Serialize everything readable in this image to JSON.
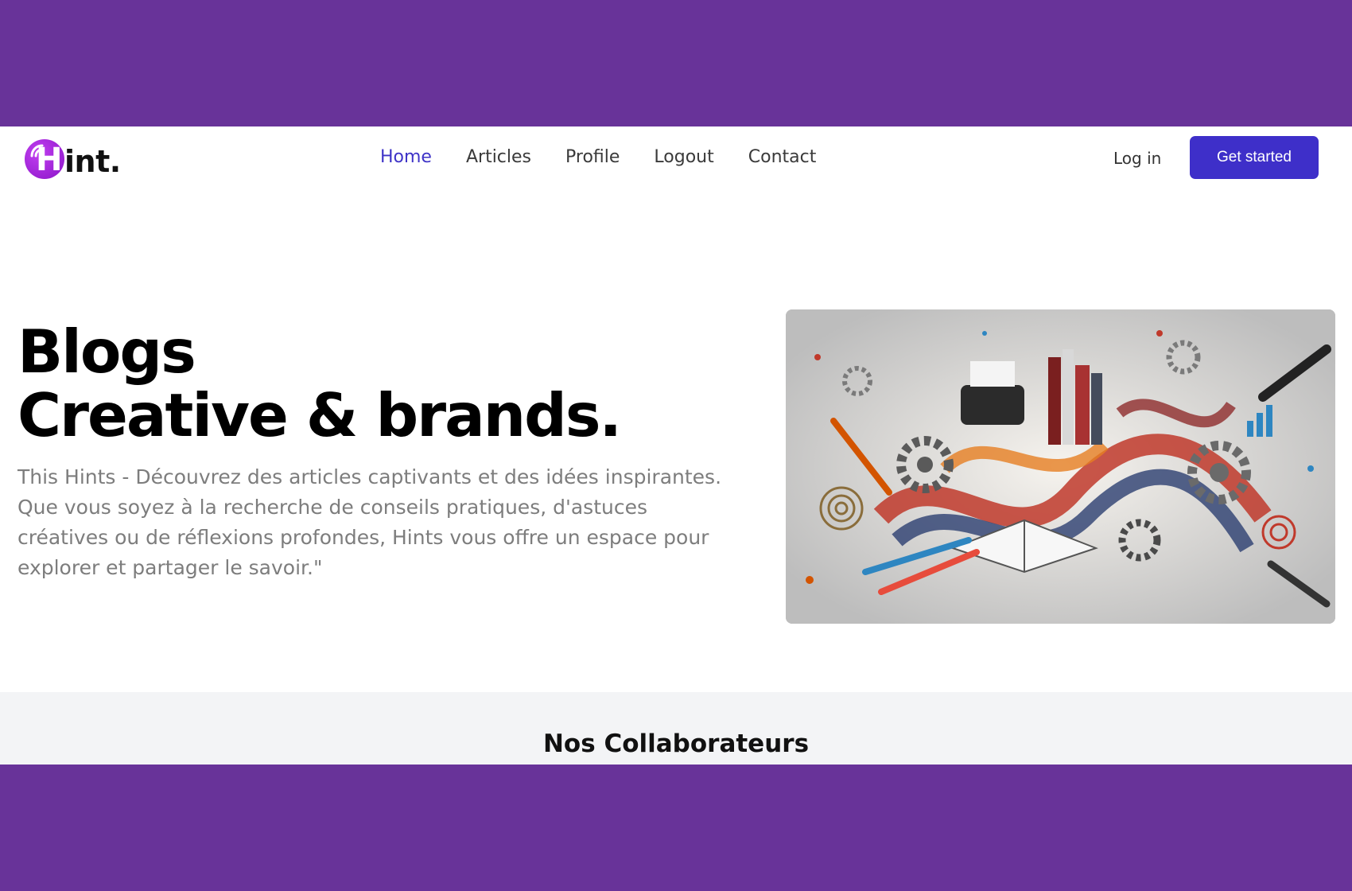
{
  "brand": {
    "name": "int.",
    "initial": "H"
  },
  "nav": {
    "items": [
      {
        "label": "Home",
        "active": true
      },
      {
        "label": "Articles",
        "active": false
      },
      {
        "label": "Profile",
        "active": false
      },
      {
        "label": "Logout",
        "active": false
      },
      {
        "label": "Contact",
        "active": false
      }
    ]
  },
  "auth": {
    "login_label": "Log in",
    "cta_label": "Get started"
  },
  "hero": {
    "title_line1": "Blogs",
    "title_line2": "Creative & brands.",
    "description": "This Hints - Découvrez des articles captivants et des idées inspirantes. Que vous soyez à la recherche de conseils pratiques, d'astuces créatives ou de réflexions profondes, Hints vous offre un espace pour explorer et partager le savoir.\"",
    "image_icon": "collage-illustration-icon"
  },
  "collaborators": {
    "heading": "Nos Collaborateurs"
  },
  "colors": {
    "backdrop": "#683399",
    "accent": "#3e2fc9",
    "nav_active": "#3e33c7",
    "logo": "#a321dc"
  }
}
